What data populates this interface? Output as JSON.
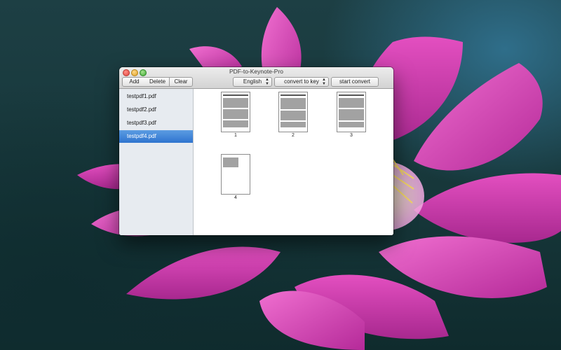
{
  "window": {
    "title": "PDF-to-Keynote-Pro"
  },
  "toolbar": {
    "add_label": "Add",
    "delete_label": "Delete",
    "clear_label": "Clear",
    "language_selected": "English",
    "format_selected": "convert to key",
    "start_label": "start convert"
  },
  "sidebar": {
    "files": [
      "testpdf1.pdf",
      "testpdf2.pdf",
      "testpdf3.pdf",
      "testpdf4.pdf"
    ],
    "selected_index": 3
  },
  "pages": [
    "1",
    "2",
    "3",
    "4"
  ],
  "colors": {
    "selection": "#2f74cf",
    "accent_flower": "#d63fb0"
  }
}
